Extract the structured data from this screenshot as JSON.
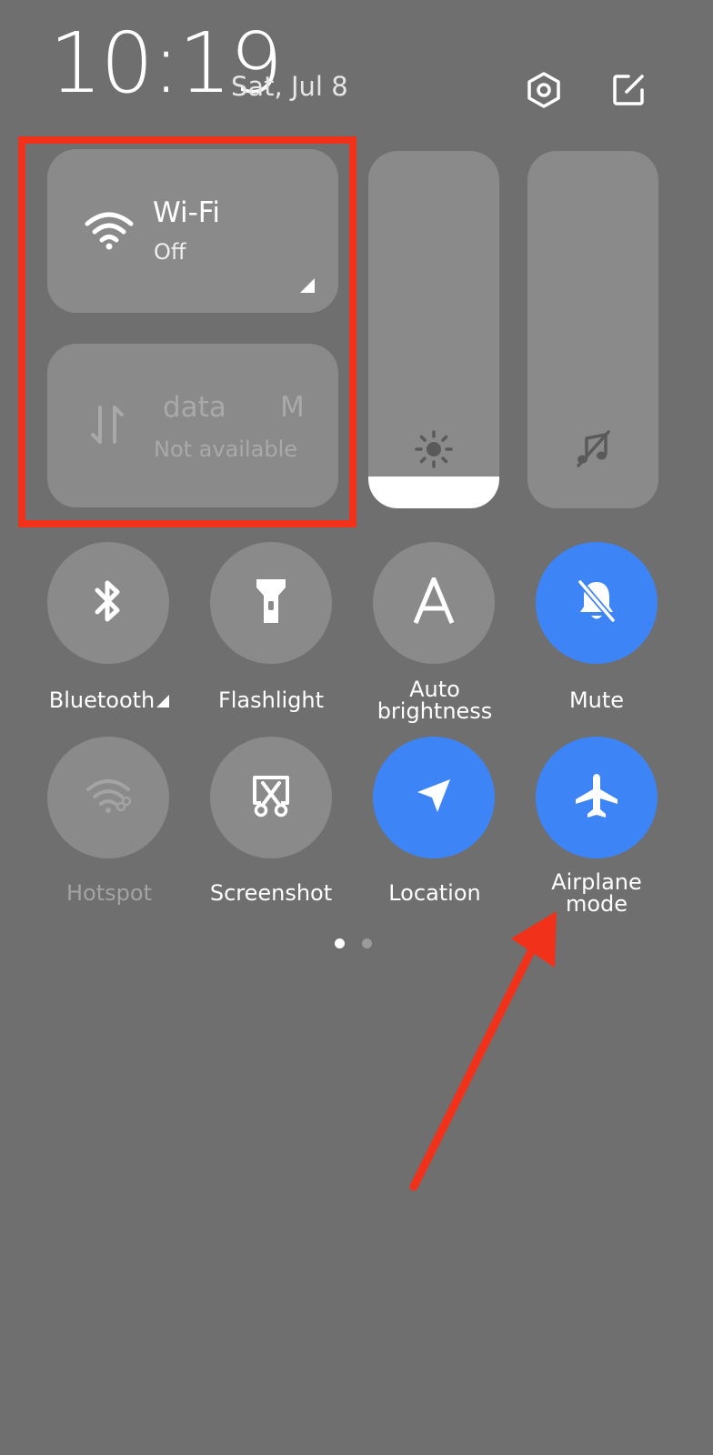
{
  "status": {
    "time": "10:19",
    "date": "Sat, Jul 8"
  },
  "header_icons": [
    "settings-icon",
    "edit-icon"
  ],
  "tiles": {
    "wifi": {
      "title": "Wi-Fi",
      "subtitle": "Off",
      "icon": "wifi-icon"
    },
    "mobile_data": {
      "title": "data",
      "title_right": "M",
      "subtitle": "Not available",
      "icon": "data-transfer-icon"
    }
  },
  "sliders": {
    "brightness": {
      "icon": "sun-icon",
      "level": 0.09
    },
    "volume": {
      "icon": "music-off-icon",
      "level": 0.0
    }
  },
  "toggles": [
    {
      "label": "Bluetooth",
      "icon": "bluetooth-icon",
      "active": false
    },
    {
      "label": "Flashlight",
      "icon": "flashlight-icon",
      "active": false
    },
    {
      "label": "Auto",
      "label2": "brightness",
      "icon": "auto-brightness-icon",
      "active": false
    },
    {
      "label": "Mute",
      "icon": "mute-bell-icon",
      "active": true
    },
    {
      "label": "Hotspot",
      "icon": "hotspot-icon",
      "active": false,
      "disabled": true
    },
    {
      "label": "Screenshot",
      "icon": "screenshot-icon",
      "active": false
    },
    {
      "label": "Location",
      "icon": "location-icon",
      "active": true
    },
    {
      "label": "Airplane",
      "label2": "mode",
      "icon": "airplane-icon",
      "active": true
    }
  ],
  "pagination": {
    "pages": 2,
    "current": 1
  },
  "colors": {
    "background": "#6f6f6f",
    "tile": "#8a8a8a",
    "active": "#3d85f7",
    "annotation": "#f2311a"
  }
}
